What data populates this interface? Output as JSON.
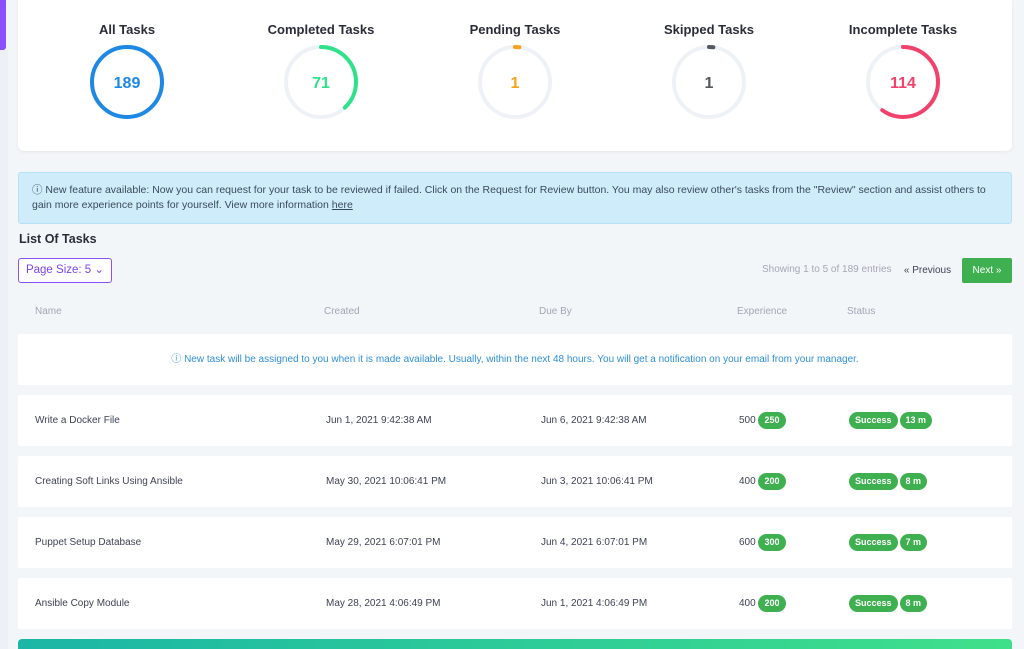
{
  "stats": [
    {
      "title": "All Tasks",
      "value": "189",
      "color": "#1e88e5",
      "fraction": 1.0
    },
    {
      "title": "Completed Tasks",
      "value": "71",
      "color": "#2fe28a",
      "fraction": 0.38
    },
    {
      "title": "Pending Tasks",
      "value": "1",
      "color": "#f7a21b",
      "fraction": 0.02
    },
    {
      "title": "Skipped Tasks",
      "value": "1",
      "color": "#55575f",
      "fraction": 0.02
    },
    {
      "title": "Incomplete Tasks",
      "value": "114",
      "color": "#f2416b",
      "fraction": 0.6
    }
  ],
  "alert": {
    "icon": "info-circle-icon",
    "text": "ⓘ New feature available: Now you can request for your task to be reviewed if failed. Click on the Request for Review button. You may also review other's tasks from the \"Review\" section and assist others to gain more experience points for yourself. View more information ",
    "link": "here"
  },
  "list": {
    "title": "List Of Tasks",
    "page_size_label": "Page Size: 5 ⌄",
    "entries_info": "Showing 1 to 5 of 189 entries",
    "prev_label": "« Previous",
    "next_label": "Next »"
  },
  "table": {
    "headers": [
      "Name",
      "Created",
      "Due By",
      "Experience",
      "Status"
    ],
    "notice": "ⓘ New task will be assigned to you when it is made available. Usually, within the next 48 hours. You will get a notification on your email from your manager.",
    "rows": [
      {
        "name": "Write a Docker File",
        "created": "Jun 1, 2021 9:42:38 AM",
        "due": "Jun 6, 2021 9:42:38 AM",
        "exp": "500",
        "exp_badge": "250",
        "status": "Success",
        "time": "13 m"
      },
      {
        "name": "Creating Soft Links Using Ansible",
        "created": "May 30, 2021 10:06:41 PM",
        "due": "Jun 3, 2021 10:06:41 PM",
        "exp": "400",
        "exp_badge": "200",
        "status": "Success",
        "time": "8 m"
      },
      {
        "name": "Puppet Setup Database",
        "created": "May 29, 2021 6:07:01 PM",
        "due": "Jun 4, 2021 6:07:01 PM",
        "exp": "600",
        "exp_badge": "300",
        "status": "Success",
        "time": "7 m"
      },
      {
        "name": "Ansible Copy Module",
        "created": "May 28, 2021 4:06:49 PM",
        "due": "Jun 1, 2021 4:06:49 PM",
        "exp": "400",
        "exp_badge": "200",
        "status": "Success",
        "time": "8 m"
      }
    ]
  },
  "colors": {
    "accent": "#8950fc",
    "success": "#3eb04f",
    "info": "#2f8fdc"
  }
}
